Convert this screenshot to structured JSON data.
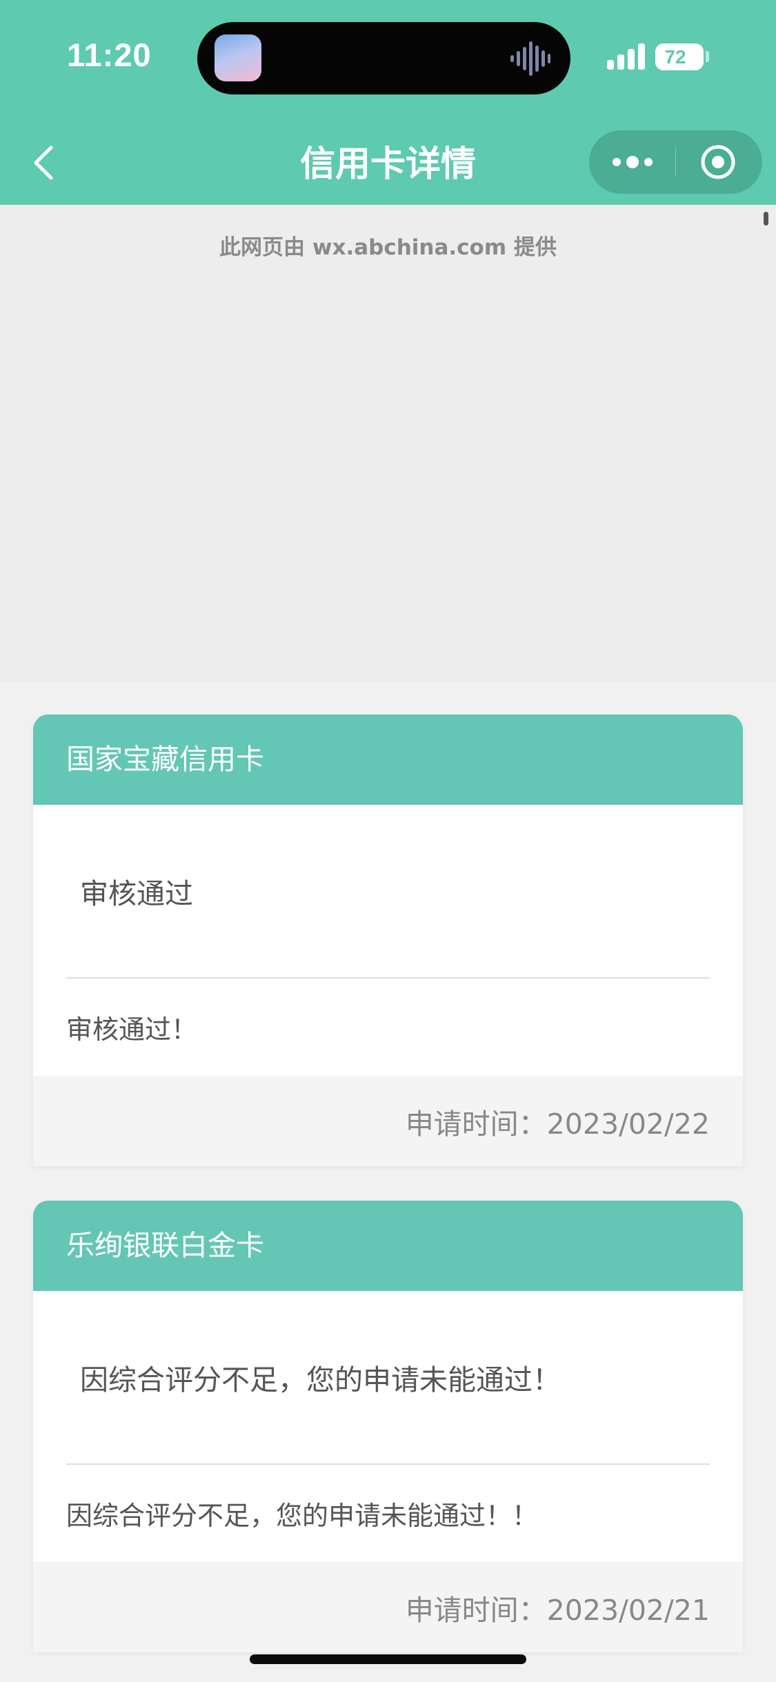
{
  "status_bar": {
    "time": "11:20",
    "battery_level": "72",
    "battery_fraction": 0.72
  },
  "nav": {
    "title": "信用卡详情",
    "back_icon": "chevron-left-icon",
    "more_icon": "more-dots-icon",
    "close_icon": "target-circle-icon"
  },
  "provider_text": "此网页由 wx.abchina.com 提供",
  "cards": [
    {
      "name": "国家宝藏信用卡",
      "status": "审核通过",
      "message": "审核通过！",
      "apply_time": "申请时间：2023/02/22"
    },
    {
      "name": "乐绚银联白金卡",
      "status": "因综合评分不足，您的申请未能通过！",
      "message": "因综合评分不足，您的申请未能通过！！",
      "apply_time": "申请时间：2023/02/21"
    }
  ],
  "colors": {
    "header_bg": "#5ecab0",
    "card_header_bg": "#64c6b4",
    "page_bg": "#efefef"
  }
}
